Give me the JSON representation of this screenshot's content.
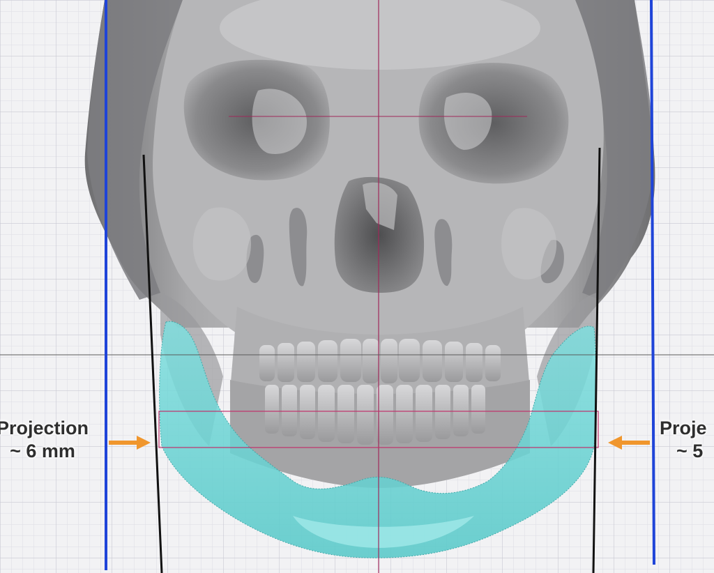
{
  "annotations": {
    "left": {
      "line1": "Projection",
      "line2": "~ 6 mm"
    },
    "right": {
      "line1": "Proje",
      "line2": "~ 5"
    }
  },
  "colors": {
    "background": "#f2f2f4",
    "grid_minor": "#dcdce3",
    "grid_major": "#c8c8d2",
    "bone": "#a9a9ab",
    "implant": "#6fd6d6",
    "reference_line_blue": "#1f44d8",
    "reference_line_black": "#111111",
    "midline_magenta": "#a0285a",
    "horizontal_gray": "#5a5a5a",
    "arrow_orange": "#f0962d"
  },
  "icons": [
    "arrow-right-icon",
    "arrow-left-icon"
  ]
}
